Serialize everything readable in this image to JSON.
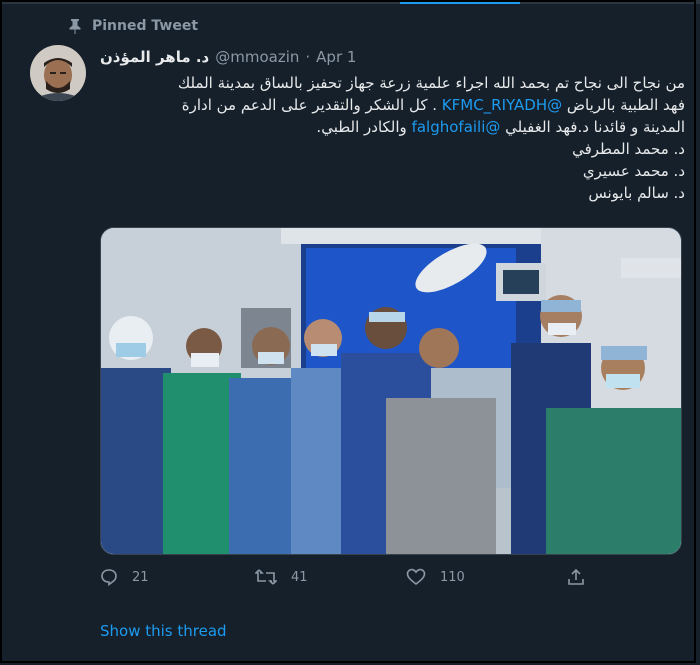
{
  "pinned_label": "Pinned Tweet",
  "tweet": {
    "display_name": "د. ماهر المؤذن",
    "handle": "@mmoazin",
    "separator": "·",
    "date": "Apr 1",
    "text": {
      "line1": "من نجاح الى نجاح تم بحمد الله اجراء علمية زرعة جهاز تحفيز بالساق بمدينة الملك",
      "line2_before": "فهد الطبية بالرياض ",
      "line2_mention": "@KFMC_RIYADH",
      "line2_after": " . كل الشكر والتقدير على الدعم من ادارة",
      "line3_before": "المدينة و قائدنا د.فهد الغفيلي ",
      "line3_mention": "@falghofaili",
      "line3_after": " والكادر الطبي.",
      "line4": "د. محمد المطرفي",
      "line5": "د. محمد عسيري",
      "line6": "د. سالم بايونس"
    }
  },
  "actions": {
    "reply_count": "21",
    "retweet_count": "41",
    "like_count": "110"
  },
  "show_thread_label": "Show this thread",
  "colors": {
    "background": "#15202b",
    "accent": "#1d9bf0",
    "muted": "#8b98a5",
    "text": "#e7e9ea"
  },
  "icons": [
    "pin-icon",
    "reply-icon",
    "retweet-icon",
    "like-icon",
    "share-icon"
  ]
}
